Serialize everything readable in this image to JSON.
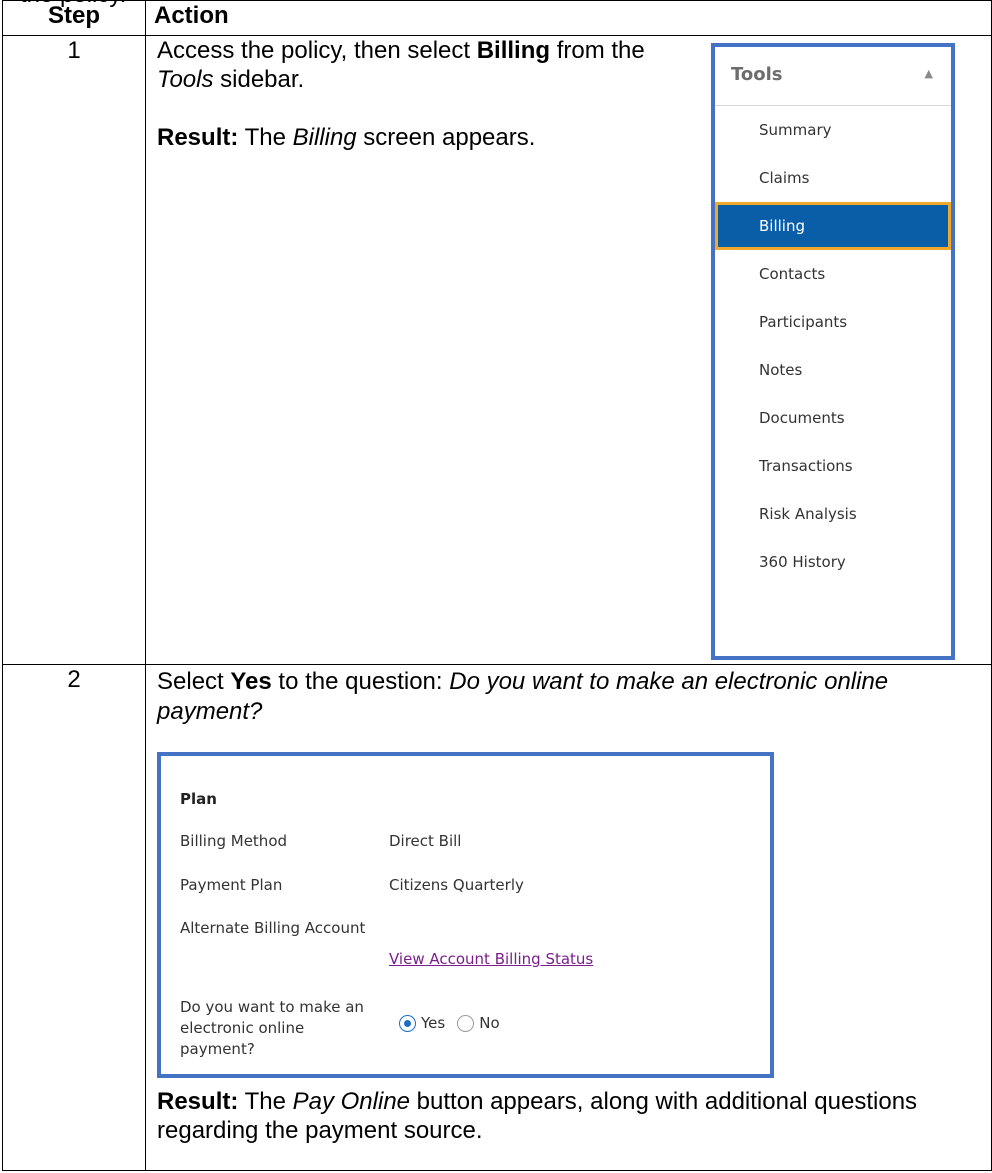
{
  "clipped_heading": "the policy.",
  "table": {
    "header_step": "Step",
    "header_action": "Action"
  },
  "step1": {
    "number": "1",
    "line_parts": [
      "Access the policy, then select ",
      "Billing",
      " from the ",
      "Tools",
      " sidebar."
    ],
    "result_parts": [
      "Result:",
      " The ",
      "Billing",
      " screen appears."
    ],
    "tools_panel": {
      "title": "Tools",
      "caret_icon": "caret-up-icon",
      "items": [
        "Summary",
        "Claims",
        "Billing",
        "Contacts",
        "Participants",
        "Notes",
        "Documents",
        "Transactions",
        "Risk Analysis",
        "360 History"
      ],
      "selected": "Billing",
      "selected_bg": "#0a5ea8",
      "highlight_border": "#f0a92a",
      "frame_color": "#4472c4"
    }
  },
  "step2": {
    "number": "2",
    "line_parts": [
      "Select ",
      "Yes",
      " to the question: ",
      "Do you want to make an electronic online payment?"
    ],
    "plan_panel": {
      "title": "Plan",
      "rows": [
        {
          "label": "Billing Method",
          "value": "Direct Bill"
        },
        {
          "label": "Payment Plan",
          "value": "Citizens Quarterly"
        },
        {
          "label": "Alternate Billing Account",
          "value": ""
        }
      ],
      "link": "View Account Billing Status",
      "question": "Do you want to make an electronic online payment?",
      "options": [
        "Yes",
        "No"
      ],
      "selected_option": "Yes"
    },
    "result_parts": [
      "Result:",
      " The ",
      "Pay Online",
      " button appears, along with additional questions regarding the payment source."
    ]
  }
}
